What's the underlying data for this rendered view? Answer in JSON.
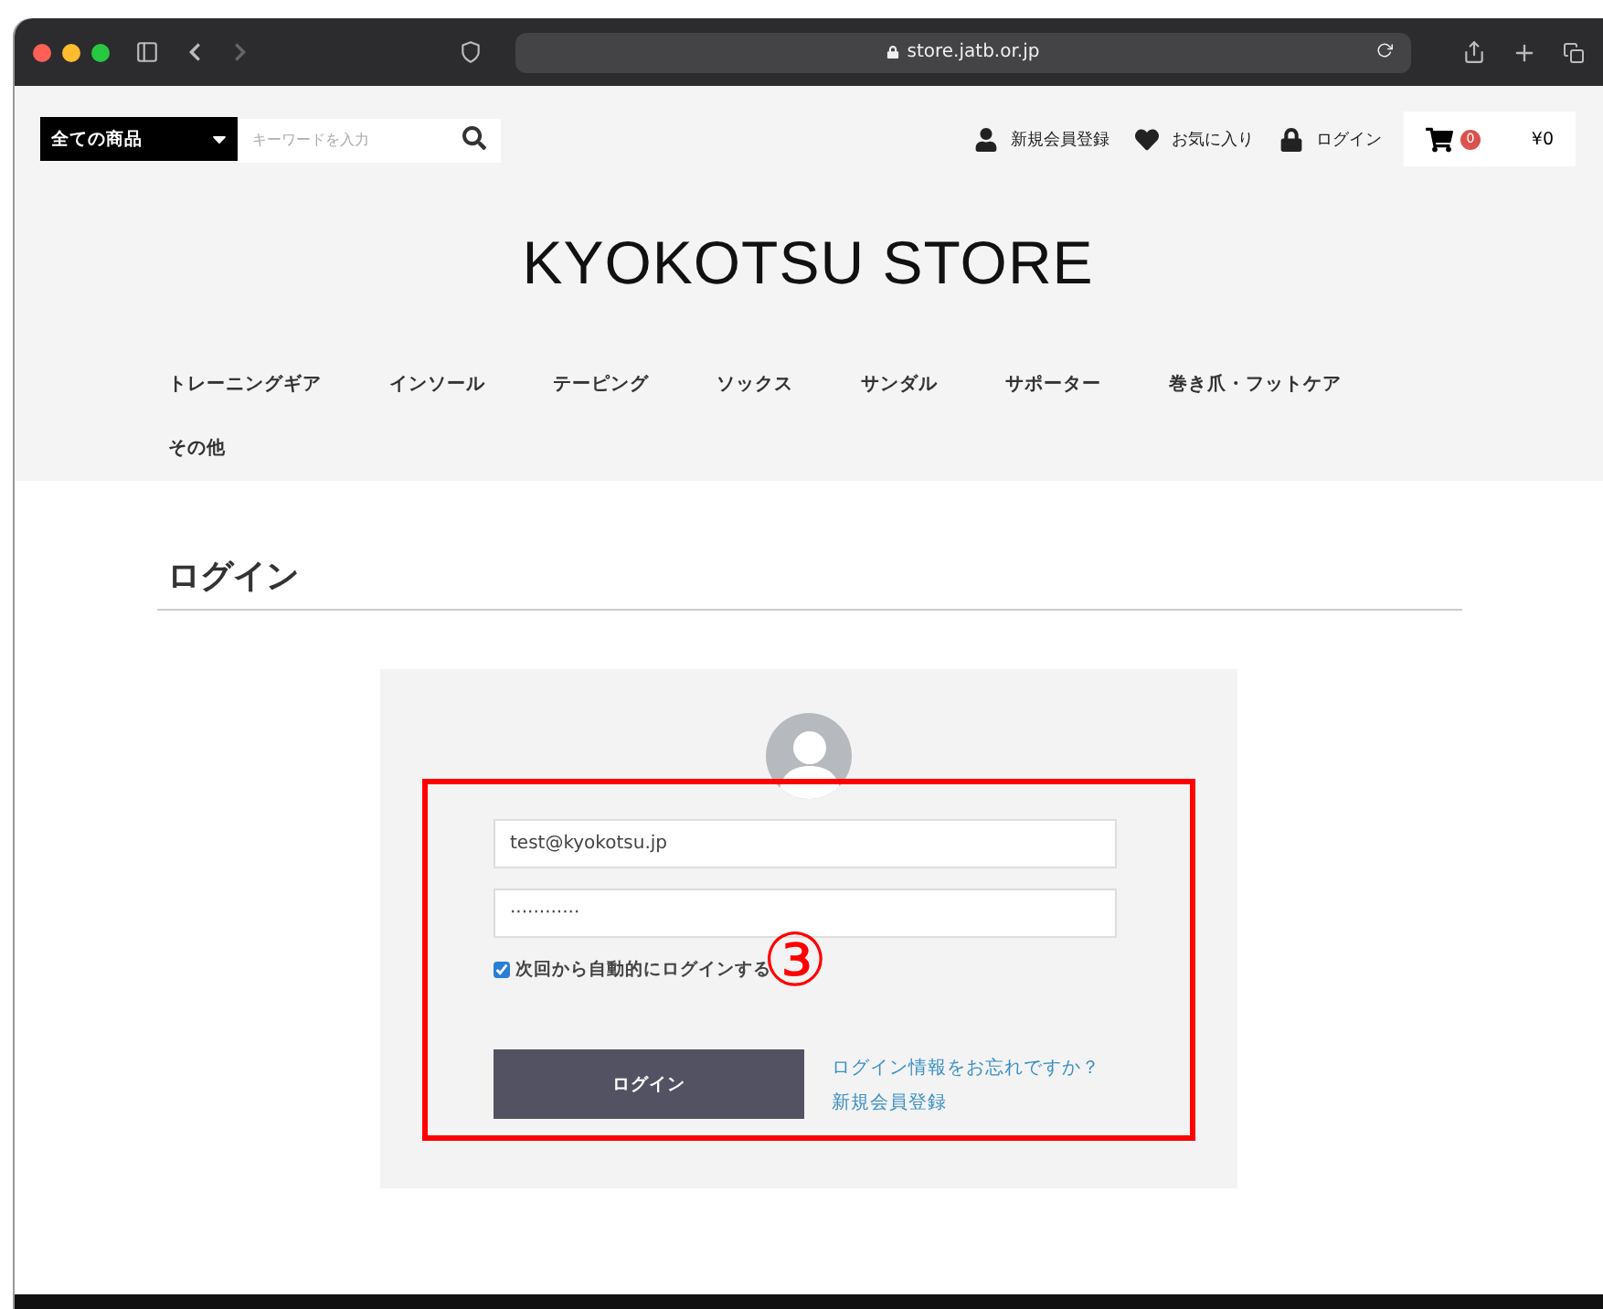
{
  "browser": {
    "url": "store.jatb.or.jp"
  },
  "header": {
    "category_select": "全ての商品",
    "search_placeholder": "キーワードを入力",
    "links": [
      {
        "kind": "user",
        "label": "新規会員登録"
      },
      {
        "kind": "heart",
        "label": "お気に入り"
      },
      {
        "kind": "lock",
        "label": "ログイン"
      }
    ],
    "cart": {
      "count": "0",
      "total": "¥0"
    }
  },
  "logo": "KYOKOTSU STORE",
  "nav": [
    "トレーニングギア",
    "インソール",
    "テーピング",
    "ソックス",
    "サンダル",
    "サポーター",
    "巻き爪・フットケア",
    "その他"
  ],
  "page_title": "ログイン",
  "login": {
    "email": "test@kyokotsu.jp",
    "password": "············",
    "remember": {
      "label": "次回から自動的にログインする",
      "checked": true
    },
    "button": "ログイン",
    "links": [
      "ログイン情報をお忘れですか？",
      "新規会員登録"
    ]
  },
  "annotation": "③"
}
